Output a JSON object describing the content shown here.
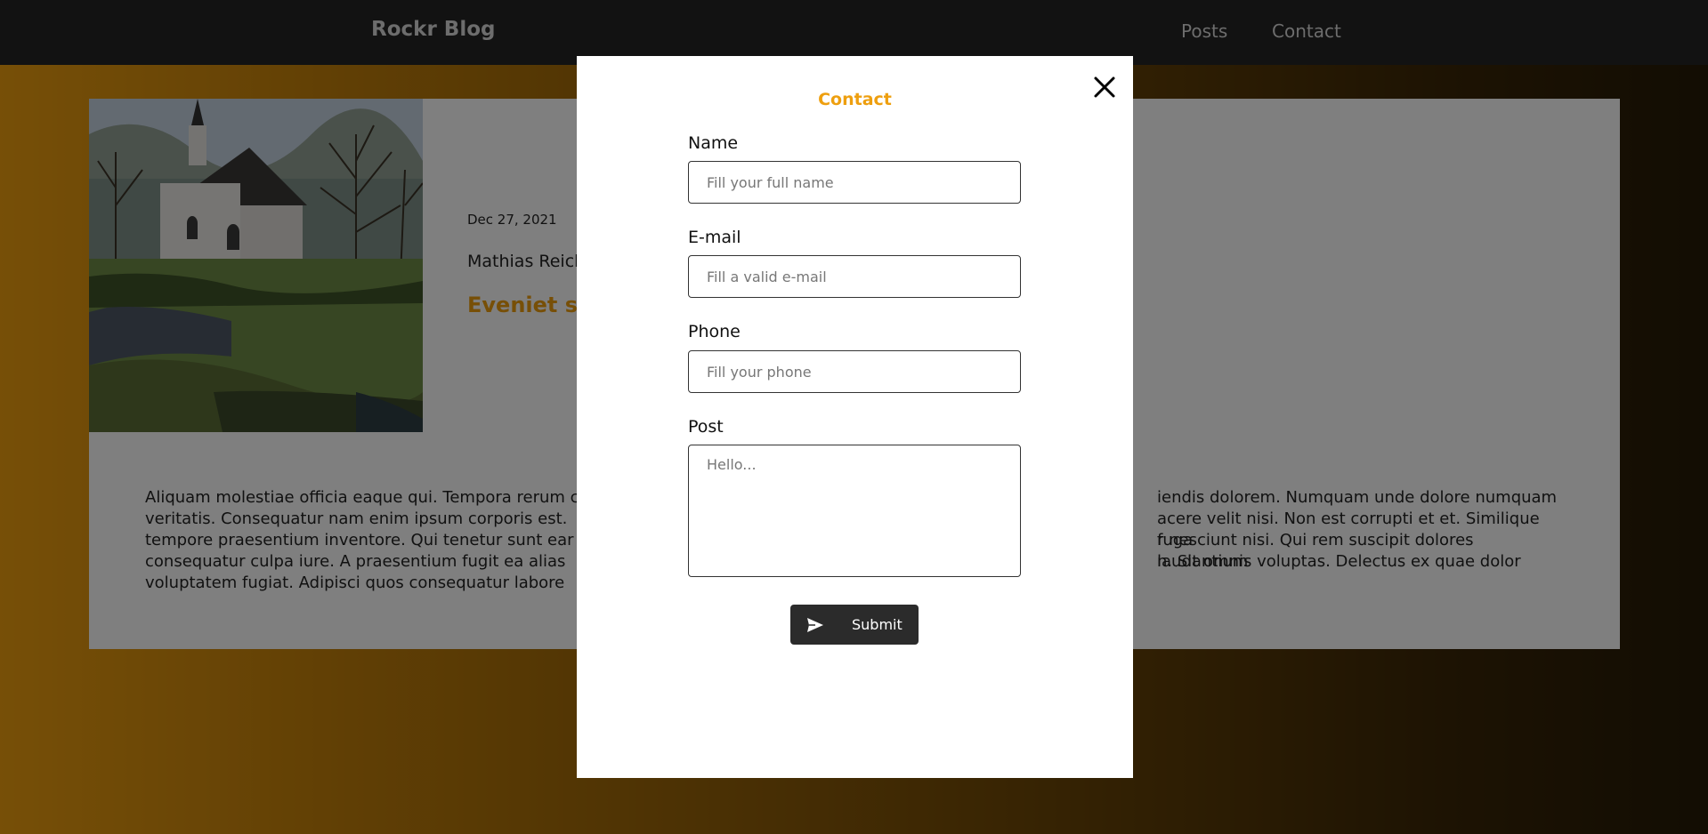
{
  "navbar": {
    "brand": "Rockr Blog",
    "links": [
      {
        "label": "Posts"
      },
      {
        "label": "Contact"
      }
    ]
  },
  "post": {
    "date": "Dec 27, 2021",
    "author": "Mathias Reich",
    "title": "Eveniet sit",
    "body": "Aliquam molestiae officia eaque qui. Tempora rerum c… …iendis dolorem. Numquam unde dolore numquam veritatis. Consequatur nam enim ipsum corporis est.… …acere velit nisi. Non est corrupti et et. Similique fuga tempore praesentium inventore. Qui tenetur sunt ear… …r nesciunt nisi. Qui rem suscipit dolores laudantium consequatur culpa iure. A praesentium fugit ea alias… …n. Sit omnis voluptas. Delectus ex quae dolor voluptatem fugiat. Adipisci quos consequatur labore…",
    "body_lines": [
      [
        "Aliquam molestiae officia eaque qui. Tempora rerum c",
        "iendis dolorem. Numquam unde dolore numquam"
      ],
      [
        "veritatis. Consequatur nam enim ipsum corporis est.",
        "acere velit nisi. Non est corrupti et et. Similique fuga"
      ],
      [
        "tempore praesentium inventore. Qui tenetur sunt ear",
        "r nesciunt nisi. Qui rem suscipit dolores laudantium"
      ],
      [
        "consequatur culpa iure. A praesentium fugit ea alias",
        "n. Sit omnis voluptas. Delectus ex quae dolor"
      ],
      [
        "voluptatem fugiat. Adipisci quos consequatur labore",
        ""
      ]
    ]
  },
  "modal": {
    "title": "Contact",
    "close_icon": "close-icon",
    "fields": {
      "name": {
        "label": "Name",
        "placeholder": "Fill your full name",
        "value": ""
      },
      "email": {
        "label": "E-mail",
        "placeholder": "Fill a valid e-mail",
        "value": ""
      },
      "phone": {
        "label": "Phone",
        "placeholder": "Fill your phone",
        "value": ""
      },
      "post": {
        "label": "Post",
        "placeholder": "Hello...",
        "value": ""
      }
    },
    "submit": {
      "label": "Submit",
      "icon": "send-icon"
    }
  },
  "colors": {
    "accent": "#ee9f0f",
    "navbar": "#121212",
    "button": "#2b2b2b"
  }
}
